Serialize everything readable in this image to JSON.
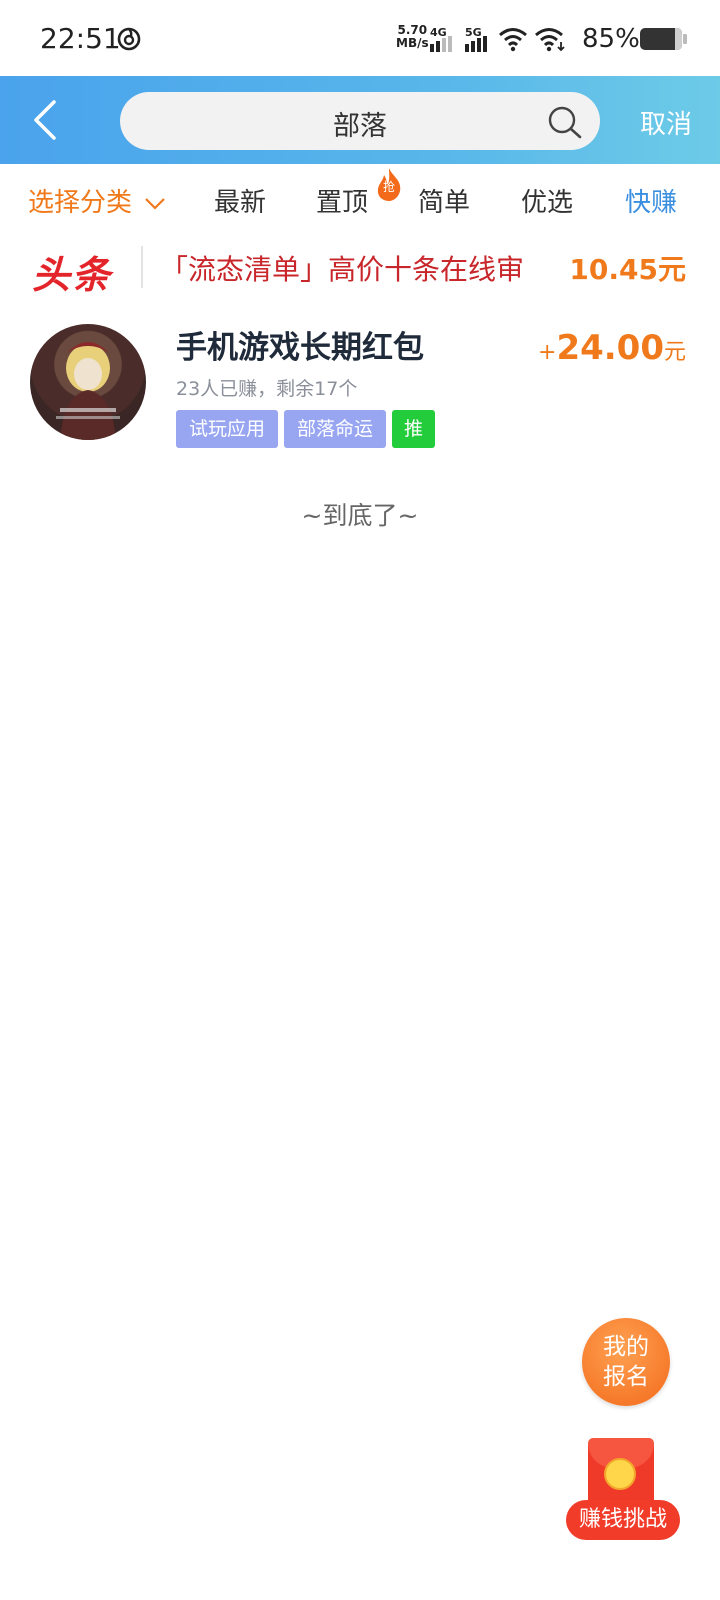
{
  "status_bar": {
    "time": "22:51",
    "net_speed_value": "5.70",
    "net_speed_unit": "MB/s",
    "sim1_type": "4G",
    "sim2_type": "5G",
    "battery": "85%",
    "icons": [
      "netease-music-icon",
      "signal-icon",
      "wifi-icon",
      "battery-icon"
    ]
  },
  "header": {
    "search_value": "部落",
    "cancel_label": "取消",
    "colors": {
      "gradient_start": "#4aa3ec",
      "gradient_end": "#6dcbe8"
    }
  },
  "filters": {
    "category_label": "选择分类",
    "tabs": [
      {
        "label": "最新"
      },
      {
        "label": "置顶",
        "badge": "抢"
      },
      {
        "label": "简单"
      },
      {
        "label": "优选"
      },
      {
        "label": "快赚"
      }
    ]
  },
  "headline": {
    "logo": "头条",
    "text": "「流态清单」高价十条在线审",
    "amount": "10.45元"
  },
  "tasks": [
    {
      "title": "手机游戏长期红包",
      "stats": "23人已赚，剩余17个",
      "tags": [
        "试玩应用",
        "部落命运",
        "推"
      ],
      "reward_plus": "+",
      "reward_amount": "24.00",
      "reward_unit": "元"
    }
  ],
  "end_text": "~到底了~",
  "floating": {
    "my_signup_line1": "我的",
    "my_signup_line2": "报名",
    "earn_challenge": "赚钱挑战"
  }
}
